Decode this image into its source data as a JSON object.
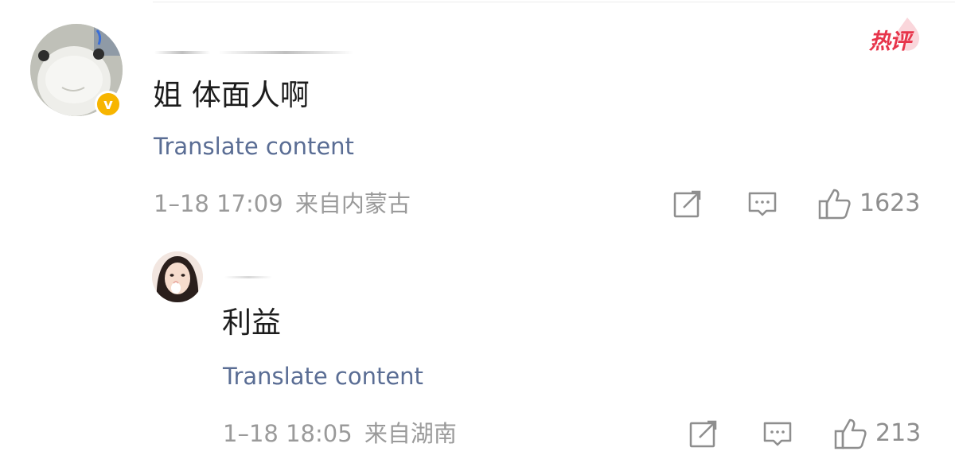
{
  "main_comment": {
    "text": "姐 体面人啊",
    "translate_label": "Translate content",
    "timestamp": "1–18 17:09",
    "location": "来自内蒙古",
    "hot_label": "热评",
    "like_count": "1623",
    "badge_icon": "v",
    "badge_color": "#f7b500"
  },
  "reply": {
    "text": "利益",
    "translate_label": "Translate content",
    "timestamp": "1–18 18:05",
    "location": "来自湖南",
    "like_count": "213"
  },
  "colors": {
    "link": "#5a6d94",
    "meta": "#9a9a9a",
    "hot": "#e7344a"
  }
}
